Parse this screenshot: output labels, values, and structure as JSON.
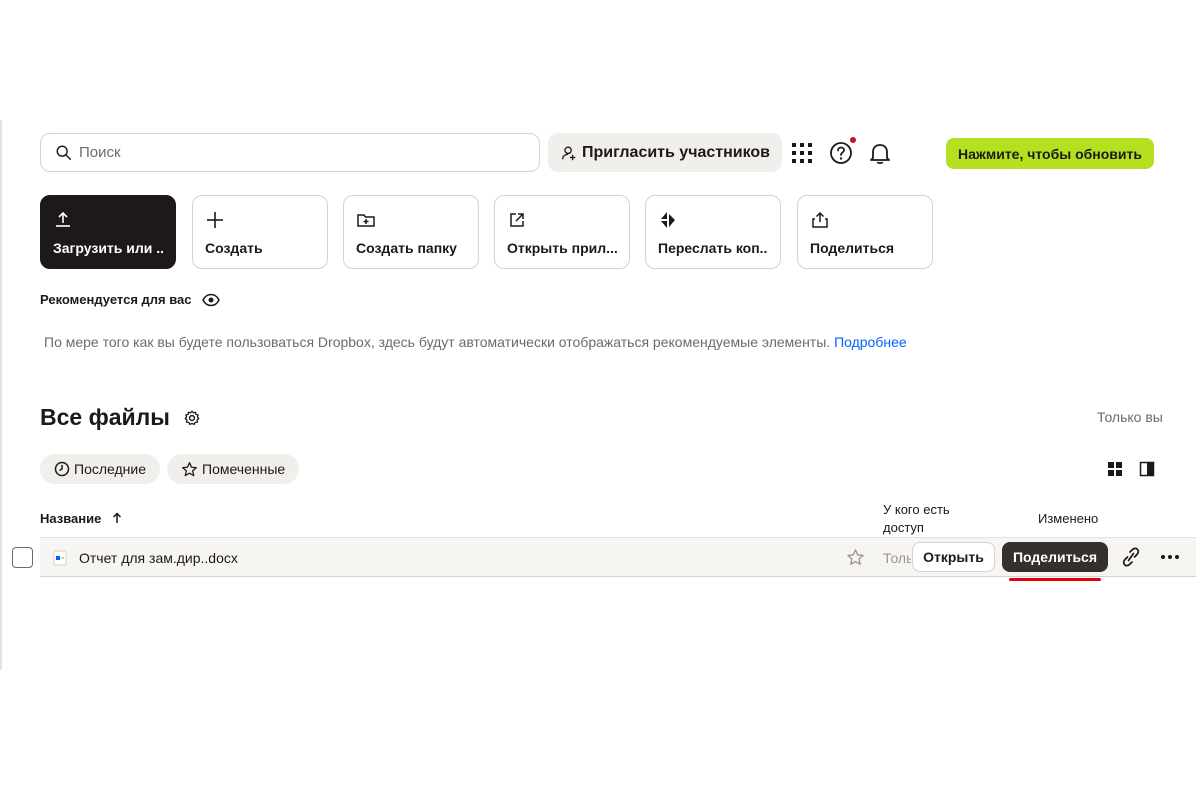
{
  "search": {
    "placeholder": "Поиск"
  },
  "toolbar": {
    "invite_label": "Пригласить участников",
    "upgrade_label": "Нажмите, чтобы обновить"
  },
  "actions": [
    {
      "label": "Загрузить или ...",
      "icon": "upload-icon"
    },
    {
      "label": "Создать",
      "icon": "plus-icon"
    },
    {
      "label": "Создать папку",
      "icon": "folder-plus-icon"
    },
    {
      "label": "Открыть прил...",
      "icon": "external-link-icon"
    },
    {
      "label": "Переслать коп...",
      "icon": "transfer-icon"
    },
    {
      "label": "Поделиться",
      "icon": "share-icon"
    }
  ],
  "recommended": {
    "title": "Рекомендуется для вас",
    "text": "По мере того как вы будете пользоваться Dropbox, здесь будут автоматически отображаться рекомендуемые элементы.",
    "link": "Подробнее"
  },
  "files": {
    "title": "Все файлы",
    "scope": "Только вы",
    "filters": [
      {
        "label": "Последние"
      },
      {
        "label": "Помеченные"
      }
    ],
    "columns": {
      "name": "Название",
      "access_line1": "У кого есть",
      "access_line2": "доступ",
      "modified": "Изменено"
    },
    "rows": [
      {
        "name": "Отчет для зам.дир..docx",
        "access": "Только вы",
        "open_label": "Открыть",
        "share_label": "Поделиться"
      }
    ]
  },
  "colors": {
    "accent_lime": "#b5e01f",
    "dark": "#1e1919",
    "link": "#0061fe",
    "highlight": "#e3000f"
  }
}
